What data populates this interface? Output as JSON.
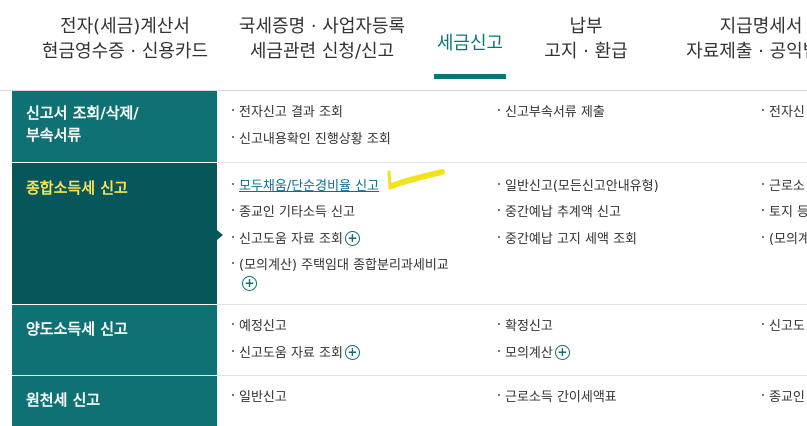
{
  "tabs": [
    {
      "line1": "전자(세금)계산서",
      "line2": "현금영수증 · 신용카드"
    },
    {
      "line1": "국세증명 · 사업자등록",
      "line2": "세금관련 신청/신고"
    },
    {
      "line1": "세금신고",
      "line2": ""
    },
    {
      "line1": "납부",
      "line2": "고지 · 환급"
    },
    {
      "line1": "지급명세서",
      "line2": "자료제출 · 공익법인"
    }
  ],
  "sidebar": [
    {
      "line1": "신고서 조회/삭제/",
      "line2": "부속서류"
    },
    {
      "line1": "종합소득세 신고",
      "line2": ""
    },
    {
      "line1": "양도소득세 신고",
      "line2": ""
    },
    {
      "line1": "원천세 신고",
      "line2": ""
    }
  ],
  "content": {
    "sec1": {
      "a1": "전자신고 결과 조회",
      "a2": "신고내용확인 진행상황 조회",
      "b1": "신고부속서류 제출",
      "c1": "전자신"
    },
    "sec2": {
      "a1": "모두채움/단순경비율 신고",
      "a2": "종교인 기타소득 신고",
      "a3": "신고도움 자료 조회",
      "a4": "(모의계산) 주택임대 종합분리과세비교",
      "b1": "일반신고(모든신고안내유형)",
      "b2": "중간예납 추계액 신고",
      "b3": "중간예납 고지 세액 조회",
      "c1": "근로소",
      "c2": "토지 등",
      "c3": "(모의계"
    },
    "sec3": {
      "a1": "예정신고",
      "a2": "신고도움 자료 조회",
      "b1": "확정신고",
      "b2": "모의계산",
      "c1": "신고도"
    },
    "sec4": {
      "a1": "일반신고",
      "b1": "근로소득 간이세액표",
      "c1": "종교인"
    }
  },
  "plus_symbol": "+",
  "colors": {
    "accent": "#0b7478",
    "sidebar": "#0e7174",
    "sidebar_active": "#07575a",
    "active_text": "#f5e15a",
    "highlight": "#f2e21a"
  }
}
